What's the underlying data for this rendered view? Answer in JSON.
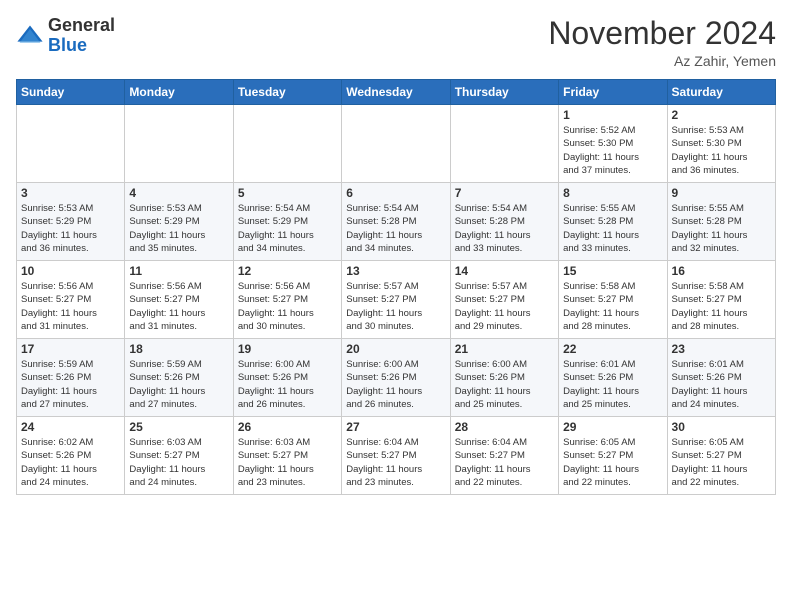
{
  "header": {
    "logo_line1": "General",
    "logo_line2": "Blue",
    "month_title": "November 2024",
    "location": "Az Zahir, Yemen"
  },
  "weekdays": [
    "Sunday",
    "Monday",
    "Tuesday",
    "Wednesday",
    "Thursday",
    "Friday",
    "Saturday"
  ],
  "weeks": [
    [
      {
        "day": "",
        "info": ""
      },
      {
        "day": "",
        "info": ""
      },
      {
        "day": "",
        "info": ""
      },
      {
        "day": "",
        "info": ""
      },
      {
        "day": "",
        "info": ""
      },
      {
        "day": "1",
        "info": "Sunrise: 5:52 AM\nSunset: 5:30 PM\nDaylight: 11 hours\nand 37 minutes."
      },
      {
        "day": "2",
        "info": "Sunrise: 5:53 AM\nSunset: 5:30 PM\nDaylight: 11 hours\nand 36 minutes."
      }
    ],
    [
      {
        "day": "3",
        "info": "Sunrise: 5:53 AM\nSunset: 5:29 PM\nDaylight: 11 hours\nand 36 minutes."
      },
      {
        "day": "4",
        "info": "Sunrise: 5:53 AM\nSunset: 5:29 PM\nDaylight: 11 hours\nand 35 minutes."
      },
      {
        "day": "5",
        "info": "Sunrise: 5:54 AM\nSunset: 5:29 PM\nDaylight: 11 hours\nand 34 minutes."
      },
      {
        "day": "6",
        "info": "Sunrise: 5:54 AM\nSunset: 5:28 PM\nDaylight: 11 hours\nand 34 minutes."
      },
      {
        "day": "7",
        "info": "Sunrise: 5:54 AM\nSunset: 5:28 PM\nDaylight: 11 hours\nand 33 minutes."
      },
      {
        "day": "8",
        "info": "Sunrise: 5:55 AM\nSunset: 5:28 PM\nDaylight: 11 hours\nand 33 minutes."
      },
      {
        "day": "9",
        "info": "Sunrise: 5:55 AM\nSunset: 5:28 PM\nDaylight: 11 hours\nand 32 minutes."
      }
    ],
    [
      {
        "day": "10",
        "info": "Sunrise: 5:56 AM\nSunset: 5:27 PM\nDaylight: 11 hours\nand 31 minutes."
      },
      {
        "day": "11",
        "info": "Sunrise: 5:56 AM\nSunset: 5:27 PM\nDaylight: 11 hours\nand 31 minutes."
      },
      {
        "day": "12",
        "info": "Sunrise: 5:56 AM\nSunset: 5:27 PM\nDaylight: 11 hours\nand 30 minutes."
      },
      {
        "day": "13",
        "info": "Sunrise: 5:57 AM\nSunset: 5:27 PM\nDaylight: 11 hours\nand 30 minutes."
      },
      {
        "day": "14",
        "info": "Sunrise: 5:57 AM\nSunset: 5:27 PM\nDaylight: 11 hours\nand 29 minutes."
      },
      {
        "day": "15",
        "info": "Sunrise: 5:58 AM\nSunset: 5:27 PM\nDaylight: 11 hours\nand 28 minutes."
      },
      {
        "day": "16",
        "info": "Sunrise: 5:58 AM\nSunset: 5:27 PM\nDaylight: 11 hours\nand 28 minutes."
      }
    ],
    [
      {
        "day": "17",
        "info": "Sunrise: 5:59 AM\nSunset: 5:26 PM\nDaylight: 11 hours\nand 27 minutes."
      },
      {
        "day": "18",
        "info": "Sunrise: 5:59 AM\nSunset: 5:26 PM\nDaylight: 11 hours\nand 27 minutes."
      },
      {
        "day": "19",
        "info": "Sunrise: 6:00 AM\nSunset: 5:26 PM\nDaylight: 11 hours\nand 26 minutes."
      },
      {
        "day": "20",
        "info": "Sunrise: 6:00 AM\nSunset: 5:26 PM\nDaylight: 11 hours\nand 26 minutes."
      },
      {
        "day": "21",
        "info": "Sunrise: 6:00 AM\nSunset: 5:26 PM\nDaylight: 11 hours\nand 25 minutes."
      },
      {
        "day": "22",
        "info": "Sunrise: 6:01 AM\nSunset: 5:26 PM\nDaylight: 11 hours\nand 25 minutes."
      },
      {
        "day": "23",
        "info": "Sunrise: 6:01 AM\nSunset: 5:26 PM\nDaylight: 11 hours\nand 24 minutes."
      }
    ],
    [
      {
        "day": "24",
        "info": "Sunrise: 6:02 AM\nSunset: 5:26 PM\nDaylight: 11 hours\nand 24 minutes."
      },
      {
        "day": "25",
        "info": "Sunrise: 6:03 AM\nSunset: 5:27 PM\nDaylight: 11 hours\nand 24 minutes."
      },
      {
        "day": "26",
        "info": "Sunrise: 6:03 AM\nSunset: 5:27 PM\nDaylight: 11 hours\nand 23 minutes."
      },
      {
        "day": "27",
        "info": "Sunrise: 6:04 AM\nSunset: 5:27 PM\nDaylight: 11 hours\nand 23 minutes."
      },
      {
        "day": "28",
        "info": "Sunrise: 6:04 AM\nSunset: 5:27 PM\nDaylight: 11 hours\nand 22 minutes."
      },
      {
        "day": "29",
        "info": "Sunrise: 6:05 AM\nSunset: 5:27 PM\nDaylight: 11 hours\nand 22 minutes."
      },
      {
        "day": "30",
        "info": "Sunrise: 6:05 AM\nSunset: 5:27 PM\nDaylight: 11 hours\nand 22 minutes."
      }
    ]
  ]
}
